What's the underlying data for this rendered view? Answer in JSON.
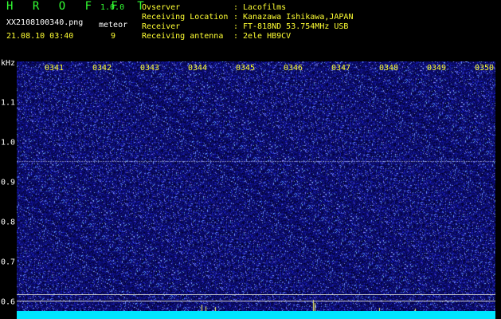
{
  "header": {
    "app_title": "H R O F F T",
    "app_version": "1.0.0",
    "file_name": "XX2108100340.png",
    "meteor_label": "meteor",
    "date_time": "21.08.10 03:40",
    "meteor_count": "9"
  },
  "info": [
    {
      "label": "Ovserver",
      "value": "Lacofilms"
    },
    {
      "label": "Receiving Location",
      "value": "Kanazawa Ishikawa,JAPAN"
    },
    {
      "label": "Receiver",
      "value": "FT-818ND 53.754MHz USB"
    },
    {
      "label": "Receiving antenna",
      "value": "2ele HB9CV"
    }
  ],
  "info_separator": ":",
  "spectrogram": {
    "y_unit": "kHz",
    "x_ticks": [
      "0341",
      "0342",
      "0343",
      "0344",
      "0345",
      "0346",
      "0347",
      "0348",
      "0349",
      "0350"
    ],
    "y_ticks": [
      "1.1",
      "1.0",
      "0.9",
      "0.8",
      "0.7",
      "0.6"
    ],
    "y_range": [
      0.58,
      1.2
    ],
    "reference_lines_khz": [
      0.62,
      0.605
    ],
    "carrier_line_khz": 0.955,
    "colors": {
      "background": "#000000",
      "noise_base": "#10106a",
      "noise_speckle": "#6a78ff",
      "bottom_bar": "#00e5ff",
      "meteor_trace": "#ffff66"
    }
  }
}
